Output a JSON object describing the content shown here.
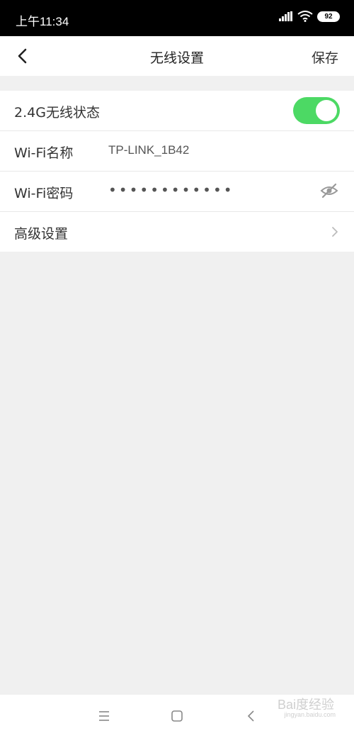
{
  "status_bar": {
    "time": "上午11:34",
    "battery": "92",
    "icons": [
      "signal-icon",
      "wifi-icon",
      "battery-icon"
    ]
  },
  "header": {
    "title": "无线设置",
    "save_label": "保存",
    "back_icon": "back-icon"
  },
  "settings": [
    {
      "label": "2.4G无线状态",
      "toggle_on": true
    },
    {
      "label": "Wi-Fi名称",
      "value": "TP-LINK_1B42"
    },
    {
      "label": "Wi-Fi密码",
      "value": "••••••••••••",
      "icon": "eye-off-icon"
    },
    {
      "label": "高级设置",
      "icon": "chevron-right-icon"
    }
  ],
  "nav_bar": {
    "icons": [
      "menu-icon",
      "home-icon",
      "back-icon"
    ]
  },
  "watermark": {
    "text": "Bai度经验",
    "sub": "jingyan.baidu.com"
  },
  "colors": {
    "toggle_on": "#4cd964",
    "background": "#f0f0f0",
    "status_bar": "#000000"
  }
}
